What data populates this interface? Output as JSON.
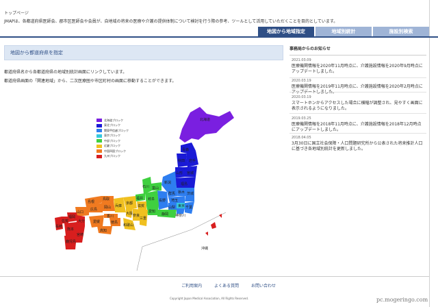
{
  "breadcrumb": "トップページ",
  "intro": "JMAPは、各都道府県医師会、郡市区医師会や会員が、自地域の将来の医療や介護の提供体制について検討を行う際の参考、ツールとして活用していただくことを目的としています。",
  "tabs": [
    {
      "label": "地図から地域指定"
    },
    {
      "label": "地域別統計"
    },
    {
      "label": "施設別検索"
    }
  ],
  "section": {
    "title": "地図から都道府県を指定",
    "desc1": "都道府県名から各都道府県の地域別統計画面にリンクしています。",
    "desc2": "都道府県画面の「関連地域」から、二次医療圏や市区町村の画面に移動することができます。"
  },
  "legend": [
    {
      "label": "北海道ブロック",
      "color": "#7a1fe0"
    },
    {
      "label": "東北ブロック",
      "color": "#1a1ad6"
    },
    {
      "label": "関東甲信越ブロック",
      "color": "#2e7ef0"
    },
    {
      "label": "東京ブロック",
      "color": "#35c8e0"
    },
    {
      "label": "中部ブロック",
      "color": "#3fd03f"
    },
    {
      "label": "近畿ブロック",
      "color": "#f0c020"
    },
    {
      "label": "中国四国ブロック",
      "color": "#f07a20"
    },
    {
      "label": "九州ブロック",
      "color": "#d81e1e"
    }
  ],
  "prefectures": {
    "hokkaido": "北海道",
    "aomori": "青森",
    "akita": "秋田",
    "iwate": "岩手",
    "yamagata": "山形",
    "miyagi": "宮城",
    "niigata": "新潟",
    "fukushima": "福島",
    "ishikawa": "石川",
    "toyama": "富山",
    "nagano": "長野",
    "gunma": "群馬",
    "tochigi": "栃木",
    "ibaraki": "茨城",
    "saitama": "埼玉",
    "tokyo": "東京",
    "chiba": "千葉",
    "kanagawa": "神奈川",
    "yamanashi": "山梨",
    "gifu": "岐阜",
    "fukui": "福井",
    "shizuoka": "静岡",
    "aichi": "愛知",
    "kyoto": "京都",
    "shiga": "滋賀",
    "hyogo": "兵庫",
    "osaka": "大阪",
    "nara": "奈良",
    "mie": "三重",
    "wakayama": "和歌山",
    "tottori": "鳥取",
    "shimane": "島根",
    "okayama": "岡山",
    "hiroshima": "広島",
    "yamaguchi": "山口",
    "kagawa": "香川",
    "tokushima": "徳島",
    "ehime": "愛媛",
    "kochi": "高知",
    "fukuoka": "福岡",
    "saga": "佐賀",
    "nagasaki": "長崎",
    "oita": "大分",
    "kumamoto": "熊本",
    "miyazaki": "宮崎",
    "kagoshima": "鹿児島",
    "okinawa": "沖縄"
  },
  "news": {
    "title": "事務局からのお知らせ",
    "items": [
      {
        "date": "2021.03.09",
        "text": "医療機関情報を2020年11月時点に、介護施設情報を2020年9月時点にアップデートしました。"
      },
      {
        "date": "2020.03.19",
        "text": "医療機関情報を2019年11月時点に、介護施設情報を2020年2月時点にアップデートしました。"
      },
      {
        "date": "2020.03.19",
        "text": "スマートホンからアクセスした場合に横幅が調整され、見やすく画面に表示されるようになりました。"
      },
      {
        "date": "2019.03.25",
        "text": "医療機関情報を2018年11月時点に、介護施設情報を2018年12月時点にアップデートしました。"
      },
      {
        "date": "2018.04.05",
        "text": "3月30日に国立社会保障・人口問題研究所から公表された将来推計人口に基づき各地域別統計を更新しました。"
      }
    ]
  },
  "footer": {
    "links": [
      "ご利用案内",
      "よくある質問",
      "お問い合わせ"
    ],
    "copyright": "Copyright Japan Medical Association, All Rights Reserved."
  },
  "watermark": "pc.mogeringo.com"
}
